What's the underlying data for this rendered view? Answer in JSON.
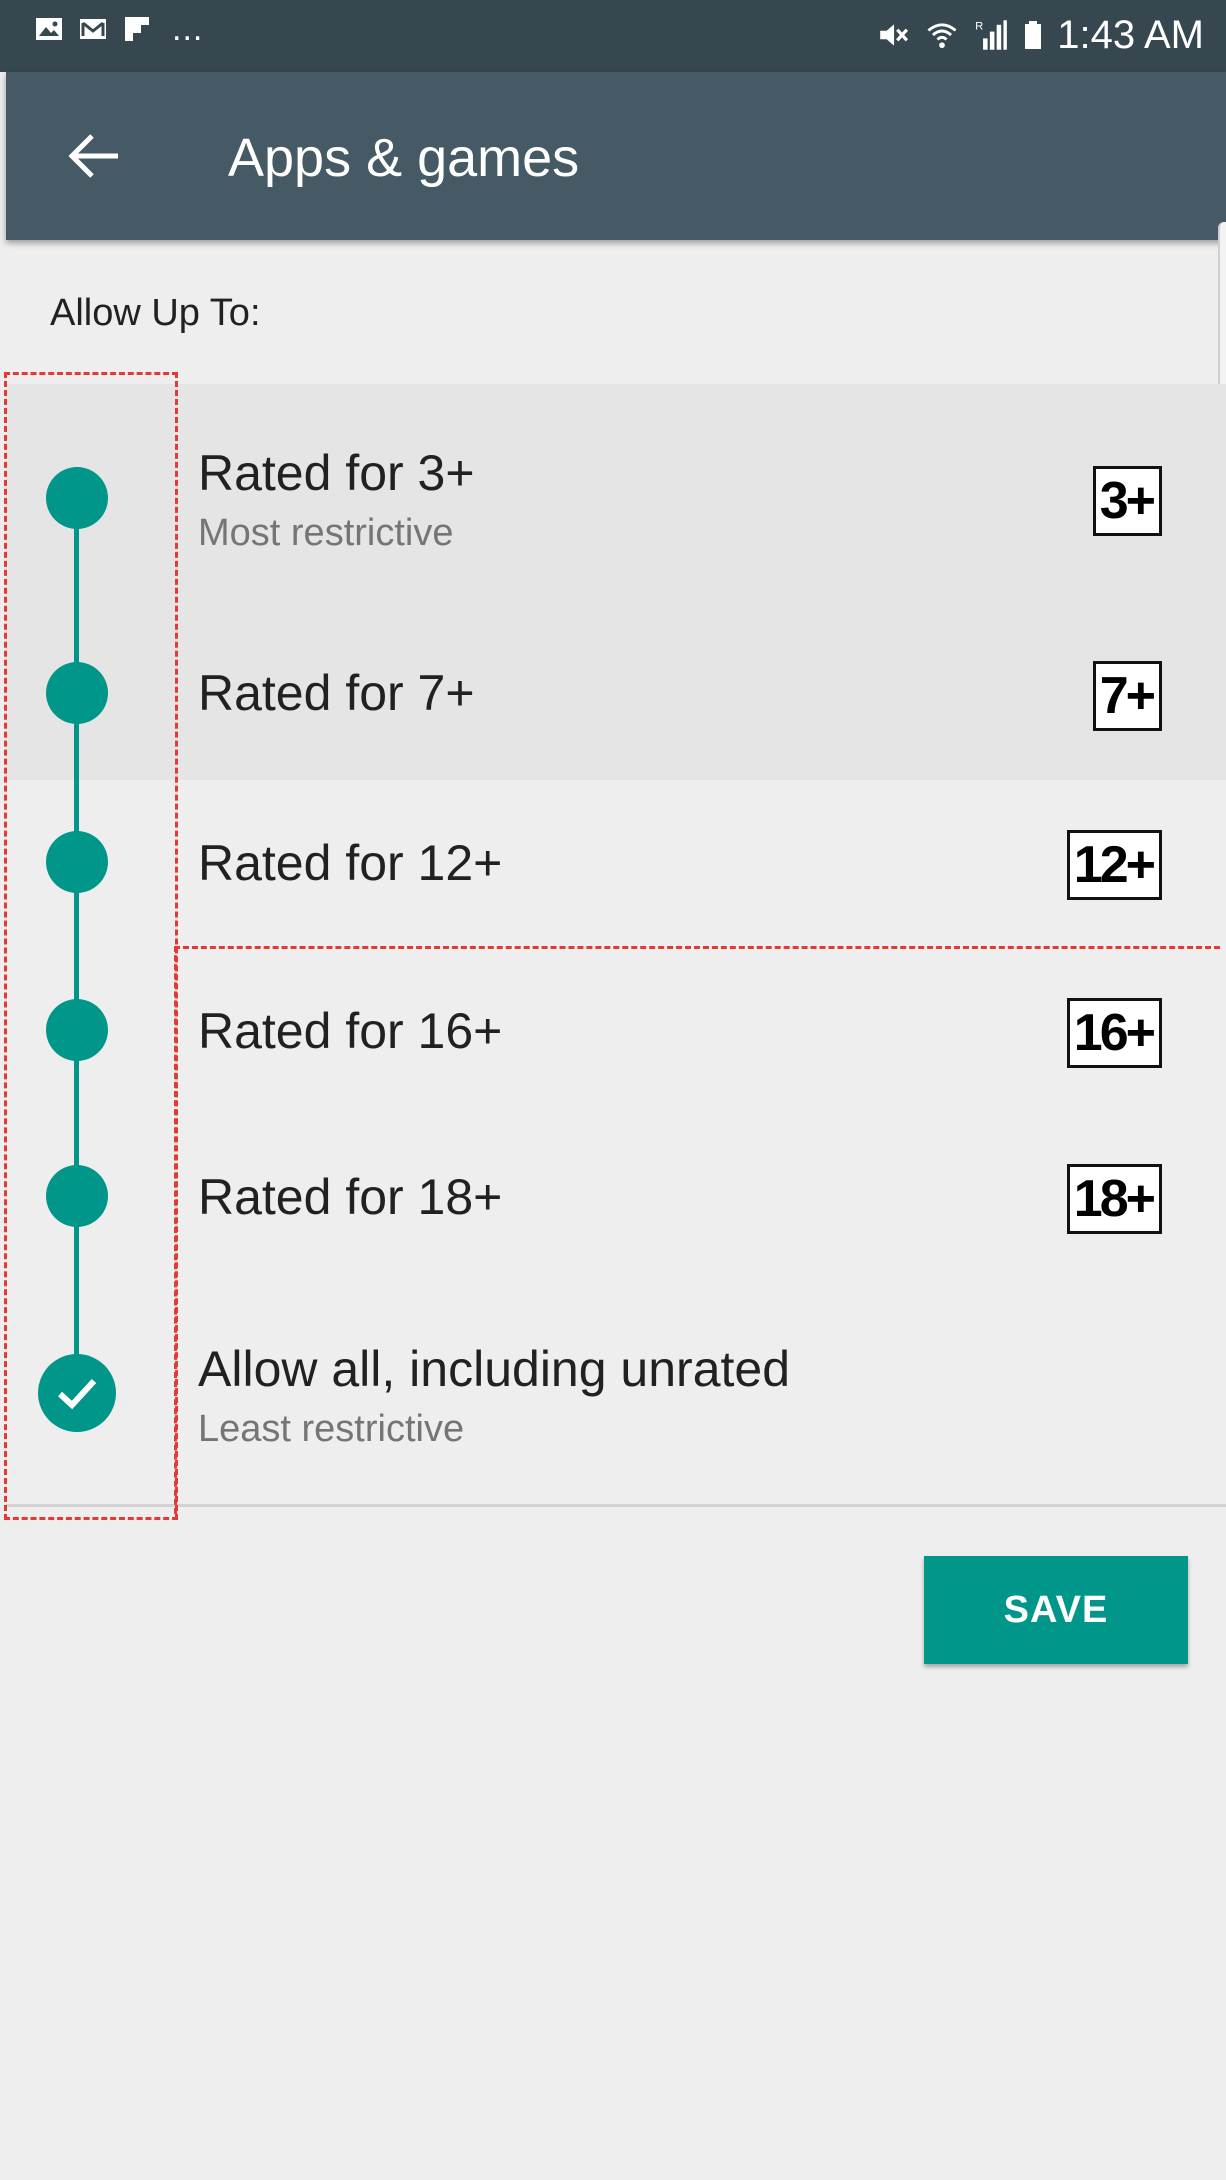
{
  "status_bar": {
    "time": "1:43 AM",
    "left_icons": [
      "gallery-icon",
      "gmail-icon",
      "flipboard-icon"
    ],
    "ellipsis": "...",
    "right_icons": [
      "mute-icon",
      "wifi-icon",
      "signal-icon",
      "battery-icon"
    ]
  },
  "app_bar": {
    "back_icon": "back-arrow-icon",
    "title": "Apps & games"
  },
  "section": {
    "label": "Allow Up To:"
  },
  "ratings": [
    {
      "title": "Rated for 3+",
      "subtitle": "Most restrictive",
      "badge": "3+"
    },
    {
      "title": "Rated for 7+",
      "badge": "7+"
    },
    {
      "title": "Rated for 12+",
      "badge": "12+"
    },
    {
      "title": "Rated for 16+",
      "badge": "16+"
    },
    {
      "title": "Rated for 18+",
      "badge": "18+"
    },
    {
      "title": "Allow all, including unrated",
      "subtitle": "Least restrictive",
      "selected": true
    }
  ],
  "actions": {
    "save_label": "SAVE"
  },
  "colors": {
    "status_bar": "#37474f",
    "app_bar": "#455a64",
    "accent": "#00968a",
    "background": "#eeeeee",
    "annotation": "#e53935"
  }
}
